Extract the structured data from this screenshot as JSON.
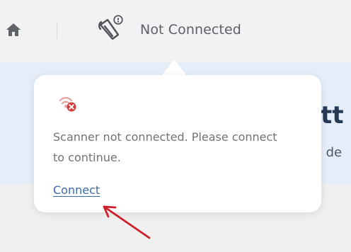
{
  "header": {
    "home_icon": "home-icon",
    "scanner_icon": "scanner-icon",
    "status": "Not Connected"
  },
  "banner": {
    "title_fragment": "ett",
    "subtitle_fragment": "c de"
  },
  "popover": {
    "icon": "wifi-error-icon",
    "message": "Scanner not connected. Please connect to continue.",
    "link_label": "Connect"
  },
  "colors": {
    "header_bg": "#f1f2f4",
    "banner_bg": "#e5eef8",
    "error_red": "#d23b3b",
    "link_blue": "#3c6ca8",
    "annotation_red": "#cc1f2a"
  }
}
